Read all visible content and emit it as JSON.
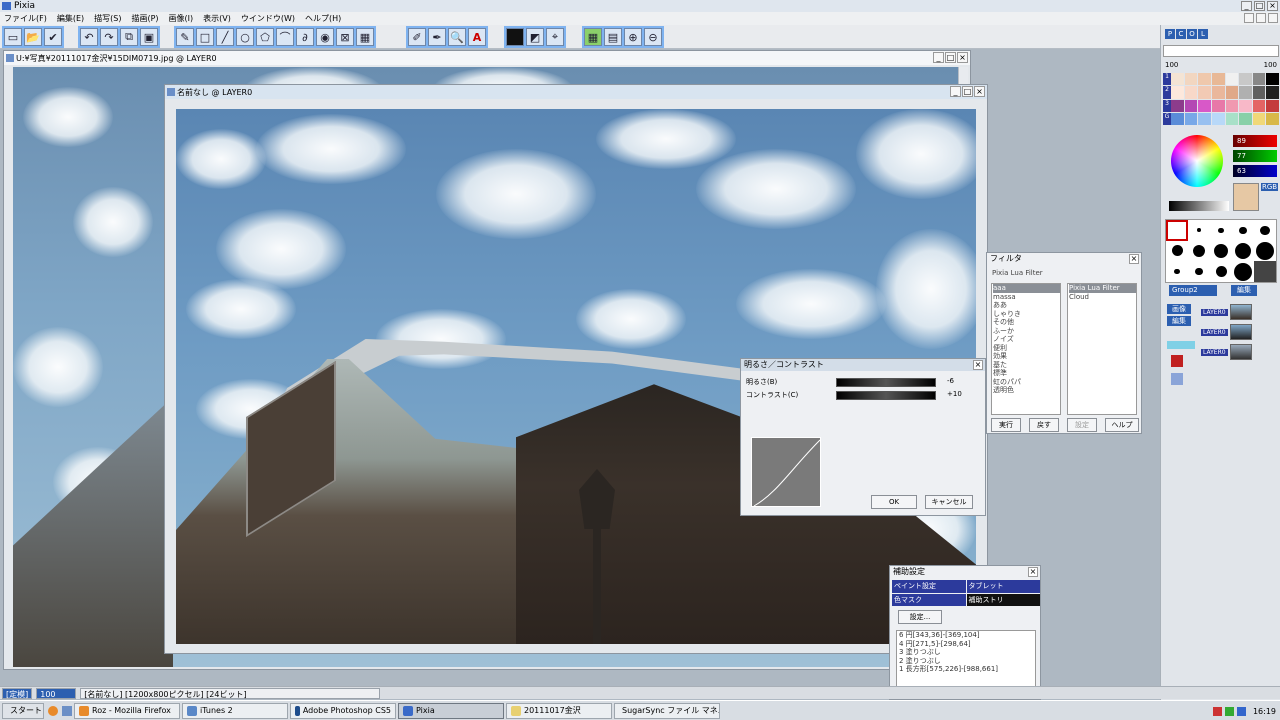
{
  "app": {
    "title": "Pixia"
  },
  "menu": [
    "ファイル(F)",
    "編集(E)",
    "描写(S)",
    "描画(P)",
    "画像(I)",
    "表示(V)",
    "ウインドウ(W)",
    "ヘルプ(H)"
  ],
  "windows": {
    "back_doc": {
      "title": "U:¥写真¥20111017金沢¥15DIM0719.jpg @ LAYER0"
    },
    "front_doc": {
      "title": "名前なし @ LAYER0"
    }
  },
  "brightness_dialog": {
    "title": "明るさ／コントラスト",
    "brightness_label": "明るさ(B)",
    "brightness_value": "-6",
    "contrast_label": "コントラスト(C)",
    "contrast_value": "+10",
    "ok": "OK",
    "cancel": "キャンセル"
  },
  "filter_panel": {
    "title": "フィルタ",
    "subtitle": "Pixia Lua Filter",
    "list": [
      "aaa",
      "massa",
      "ああ",
      "しゃりき",
      "その他",
      "ふーか",
      "ノイズ",
      "便利",
      "効果",
      "基た",
      "標準",
      "虹のパパ",
      "透明色"
    ],
    "list2": [
      "Pixia Lua Filter",
      "Cloud"
    ],
    "buttons": [
      "実行",
      "戻す",
      "設定",
      "ヘルプ"
    ]
  },
  "aux_panel": {
    "title": "補助設定",
    "cells": [
      "ペイント設定",
      "タブレット",
      "色マスク",
      "補助ストリ"
    ],
    "setting_button": "設定...",
    "log": [
      "6 円[343,36]-[369,104]",
      "4 円[271,5]-[298,64]",
      "3 塗りつぶし",
      "2 塗りつぶし",
      "1 長方形[575,226]-[988,661]"
    ]
  },
  "right_panel": {
    "tabs": [
      "P",
      "C",
      "O",
      "L"
    ],
    "opacity_a": "100",
    "opacity_b": "100",
    "rgb": [
      "89",
      "77",
      "63"
    ],
    "rgb_label": "RGB",
    "group": "Group2",
    "edit": "編集",
    "layer_buttons": [
      "画像",
      "編集"
    ],
    "layers": [
      "LAYER0",
      "LAYER0",
      "LAYER0"
    ],
    "palette_rows": [
      "1",
      "2",
      "3",
      "G"
    ]
  },
  "status": {
    "mode": "[定模]",
    "zoom": "100",
    "info": "[名前なし] [1200x800ピクセル] [24ビット]"
  },
  "taskbar": {
    "start": "スタート",
    "tasks": [
      "Roz - Mozilla Firefox",
      "iTunes 2",
      "Adobe Photoshop CS5",
      "Pixia",
      "20111017金沢",
      "SugarSync ファイル マネ..."
    ],
    "clock": "16:19"
  },
  "colors": {
    "toolbar_accent": "#7fb3f0",
    "selection_blue": "#2c3a9c",
    "status_blue": "#2c5fb0",
    "current_color": "#e6c8a4"
  }
}
